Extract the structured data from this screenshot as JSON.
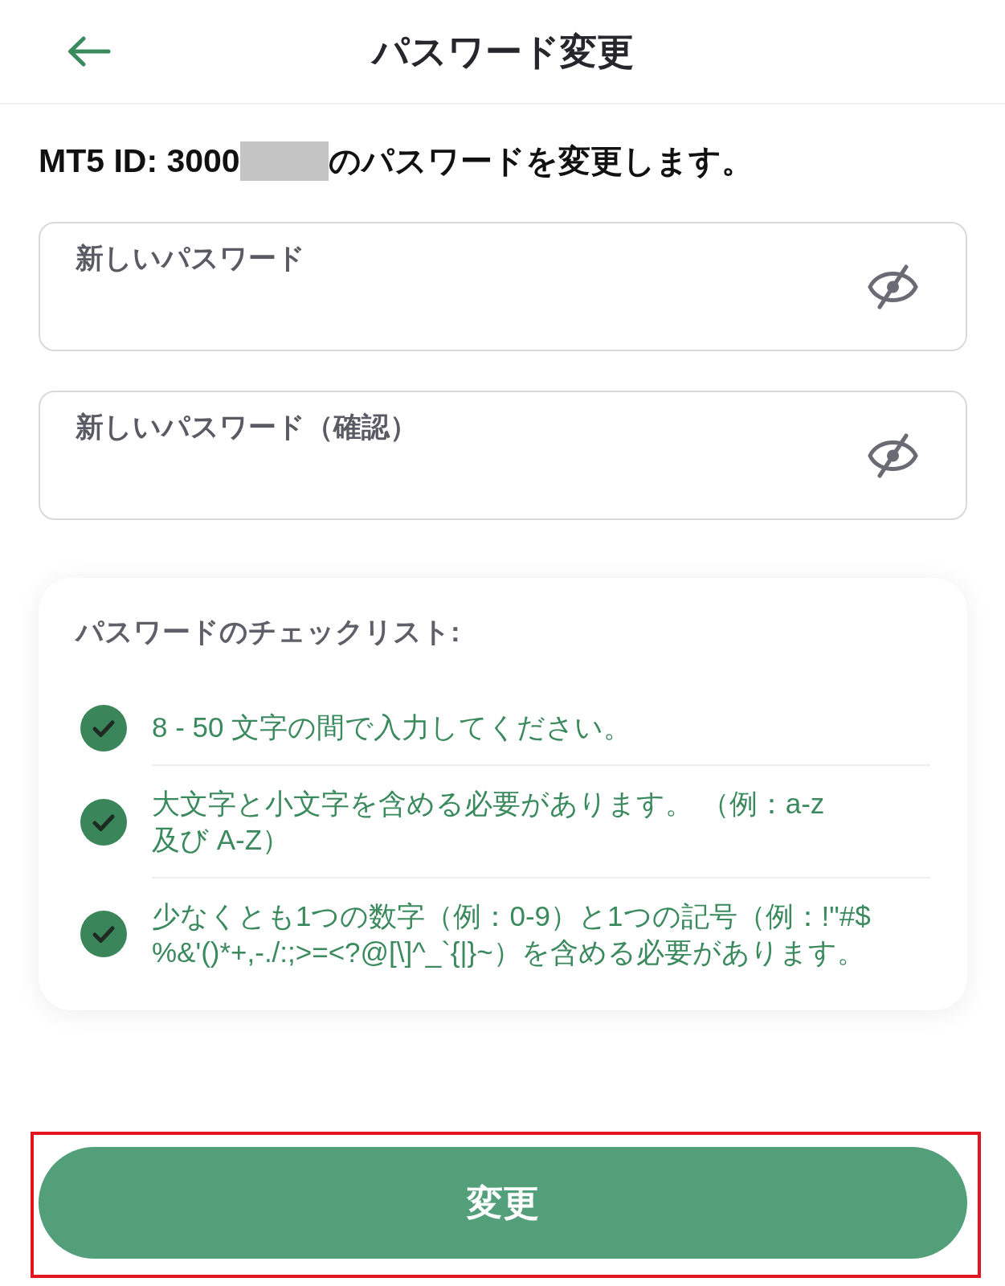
{
  "header": {
    "title": "パスワード変更"
  },
  "intro": {
    "id_text": "MT5 ID: 3000",
    "id_masked": true,
    "text": "のパスワードを変更します。"
  },
  "fields": [
    {
      "label": "新しいパスワード",
      "visible": false
    },
    {
      "label": "新しいパスワード（確認）",
      "visible": false
    }
  ],
  "checklist": {
    "title": "パスワードのチェックリスト:",
    "items": [
      {
        "text": "8 - 50 文字の間で入力してください。",
        "checked": true
      },
      {
        "text": "大文字と小文字を含める必要があります。 （例：a-z\n及び A-Z）",
        "checked": true
      },
      {
        "text": "少なくとも1つの数字（例：0-9）と1つの記号（例：!\"#$\n%&'()*+,-./:;>=<?@[\\]^_`{|}~）を含める必要があります。",
        "checked": true
      }
    ]
  },
  "submit": {
    "label": "変更",
    "highlighted": true
  }
}
